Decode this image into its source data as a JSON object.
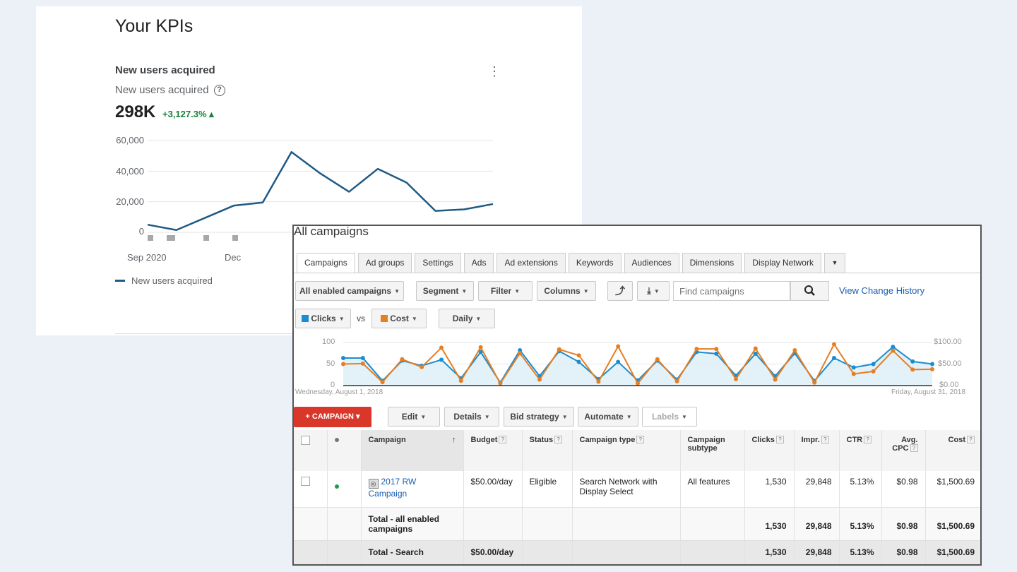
{
  "kpi": {
    "title": "Your KPIs",
    "header": "New users acquired",
    "subtitle": "New users acquired",
    "help_glyph": "?",
    "menu_glyph": "⋮",
    "value": "298K",
    "delta": "+3,127.3% ▴",
    "legend": "New users acquired",
    "chart_data": {
      "type": "line",
      "xlabel": "",
      "ylabel": "",
      "y_ticks": [
        "60,000",
        "40,000",
        "20,000",
        "0"
      ],
      "x_ticks": [
        "Sep 2020",
        "Dec"
      ],
      "ylim": [
        0,
        60000
      ],
      "grid": true,
      "series": [
        {
          "name": "New users acquired",
          "color": "#1f5a85",
          "values": [
            5000,
            1500,
            9500,
            17500,
            19500,
            52500,
            38500,
            26500,
            41500,
            32500,
            14000,
            15000,
            18500
          ]
        }
      ]
    }
  },
  "ads": {
    "title": "All campaigns",
    "tabs": [
      "Campaigns",
      "Ad groups",
      "Settings",
      "Ads",
      "Ad extensions",
      "Keywords",
      "Audiences",
      "Dimensions",
      "Display Network"
    ],
    "tab_more": "▼",
    "toolbar": {
      "all_enabled": "All enabled campaigns",
      "segment": "Segment",
      "filter": "Filter",
      "columns": "Columns",
      "search_placeholder": "Find campaigns",
      "history_link": "View Change History",
      "chart_icon": "⤴",
      "download_icon": "⤓",
      "search_icon": "🔍"
    },
    "chart_controls": {
      "metric1": "Clicks",
      "vs": "vs",
      "metric2": "Cost",
      "period": "Daily",
      "metric1_color": "#1a8dd1",
      "metric2_color": "#e67e22"
    },
    "chart_data": {
      "type": "line",
      "left_ticks": [
        "100",
        "50",
        "0"
      ],
      "right_ticks": [
        "$100.00",
        "$50.00",
        "$0.00"
      ],
      "left_ylim": [
        0,
        100
      ],
      "right_ylim": [
        0,
        100
      ],
      "start_label": "Wednesday, August 1, 2018",
      "end_label": "Friday, August 31, 2018",
      "series": [
        {
          "name": "Clicks",
          "color": "#1a8dd1",
          "values": [
            64,
            64,
            11,
            58,
            46,
            60,
            17,
            78,
            7,
            82,
            22,
            80,
            55,
            15,
            55,
            12,
            58,
            14,
            78,
            74,
            23,
            74,
            22,
            75,
            11,
            64,
            42,
            50,
            90,
            56,
            50
          ]
        },
        {
          "name": "Cost",
          "color": "#e67e22",
          "values": [
            50,
            51,
            8,
            61,
            43,
            88,
            11,
            89,
            5,
            75,
            14,
            84,
            70,
            9,
            91,
            5,
            61,
            10,
            85,
            85,
            15,
            86,
            14,
            82,
            7,
            96,
            27,
            33,
            81,
            37,
            38
          ]
        }
      ]
    },
    "actions": {
      "campaign": "+ CAMPAIGN ▾",
      "edit": "Edit",
      "details": "Details",
      "bid_strategy": "Bid strategy",
      "automate": "Automate",
      "labels": "Labels"
    },
    "table": {
      "headers": {
        "campaign": "Campaign",
        "sort_glyph": "↑",
        "budget": "Budget",
        "status": "Status",
        "campaign_type": "Campaign type",
        "campaign_subtype": "Campaign subtype",
        "clicks": "Clicks",
        "impr": "Impr.",
        "ctr": "CTR",
        "avg_cpc": "Avg. CPC",
        "cost": "Cost"
      },
      "rows": [
        {
          "campaign": "2017 RW Campaign",
          "budget": "$50.00/day",
          "status": "Eligible",
          "campaign_type": "Search Network with Display Select",
          "campaign_subtype": "All features",
          "clicks": "1,530",
          "impr": "29,848",
          "ctr": "5.13%",
          "avg_cpc": "$0.98",
          "cost": "$1,500.69",
          "status_color": "#1e9e4a"
        }
      ],
      "total_enabled": {
        "label": "Total - all enabled campaigns",
        "clicks": "1,530",
        "impr": "29,848",
        "ctr": "5.13%",
        "avg_cpc": "$0.98",
        "cost": "$1,500.69"
      },
      "total_search": {
        "label": "Total - Search",
        "budget": "$50.00/day",
        "clicks": "1,530",
        "impr": "29,848",
        "ctr": "5.13%",
        "avg_cpc": "$0.98",
        "cost": "$1,500.69"
      }
    }
  }
}
